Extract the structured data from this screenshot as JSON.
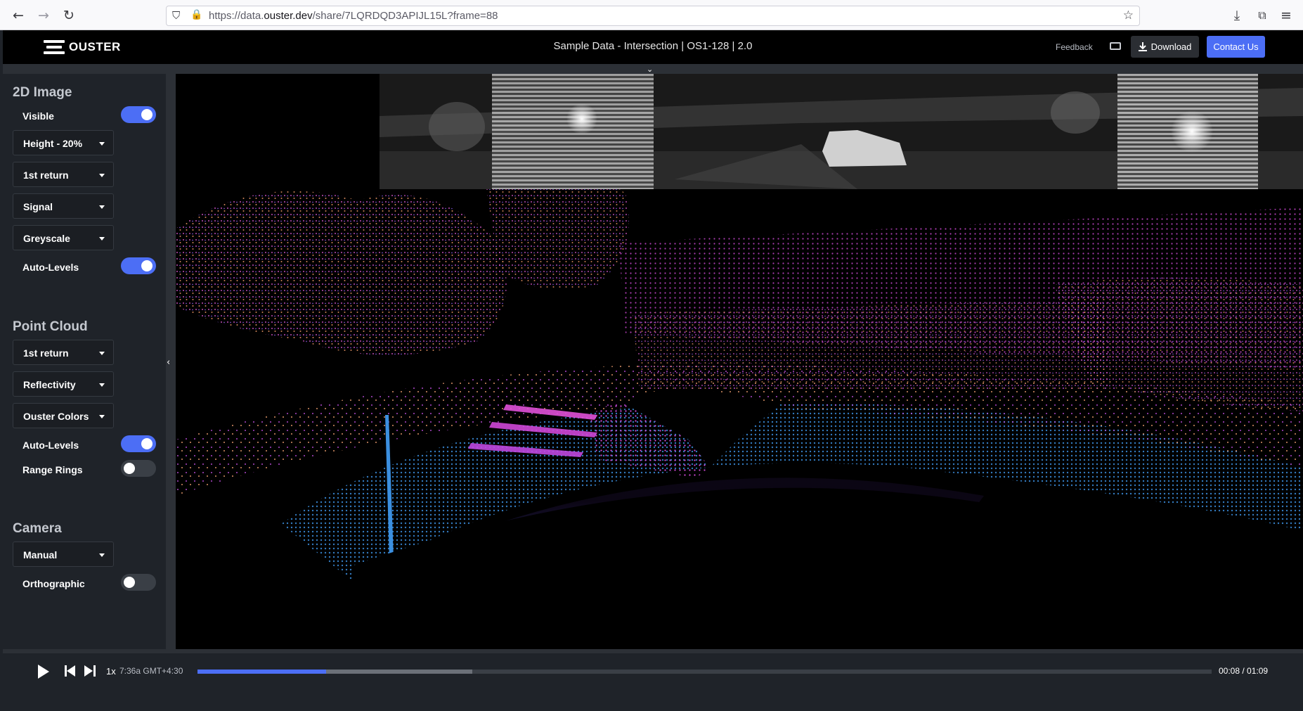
{
  "browser": {
    "url_prefix": "https://data.",
    "url_domain": "ouster.dev",
    "url_path": "/share/7LQRDQD3APIJL15L?frame=88"
  },
  "header": {
    "logo_text": "OUSTER",
    "title": "Sample Data - Intersection | OS1-128 | 2.0",
    "feedback_label": "Feedback",
    "download_label": "Download",
    "contact_label": "Contact Us"
  },
  "sidebar": {
    "image_section": {
      "title": "2D Image",
      "visible_label": "Visible",
      "visible_on": true,
      "height_select": "Height - 20%",
      "return_select": "1st return",
      "channel_select": "Signal",
      "colormap_select": "Greyscale",
      "autolevels_label": "Auto-Levels",
      "autolevels_on": true
    },
    "cloud_section": {
      "title": "Point Cloud",
      "return_select": "1st return",
      "channel_select": "Reflectivity",
      "colormap_select": "Ouster Colors",
      "autolevels_label": "Auto-Levels",
      "autolevels_on": true,
      "rings_label": "Range Rings",
      "rings_on": false
    },
    "camera_section": {
      "title": "Camera",
      "mode_select": "Manual",
      "ortho_label": "Orthographic",
      "ortho_on": false
    }
  },
  "player": {
    "speed": "1x",
    "timestamp": "7:36a GMT+4:30",
    "progress": 0.127,
    "buffered": 0.271,
    "time_readout": "00:08 / 01:09"
  },
  "colors": {
    "accent": "#4c6ef5",
    "cloud_near": "#2a7fd4",
    "cloud_far": "#e040d0",
    "cloud_hot": "#f6a060"
  }
}
